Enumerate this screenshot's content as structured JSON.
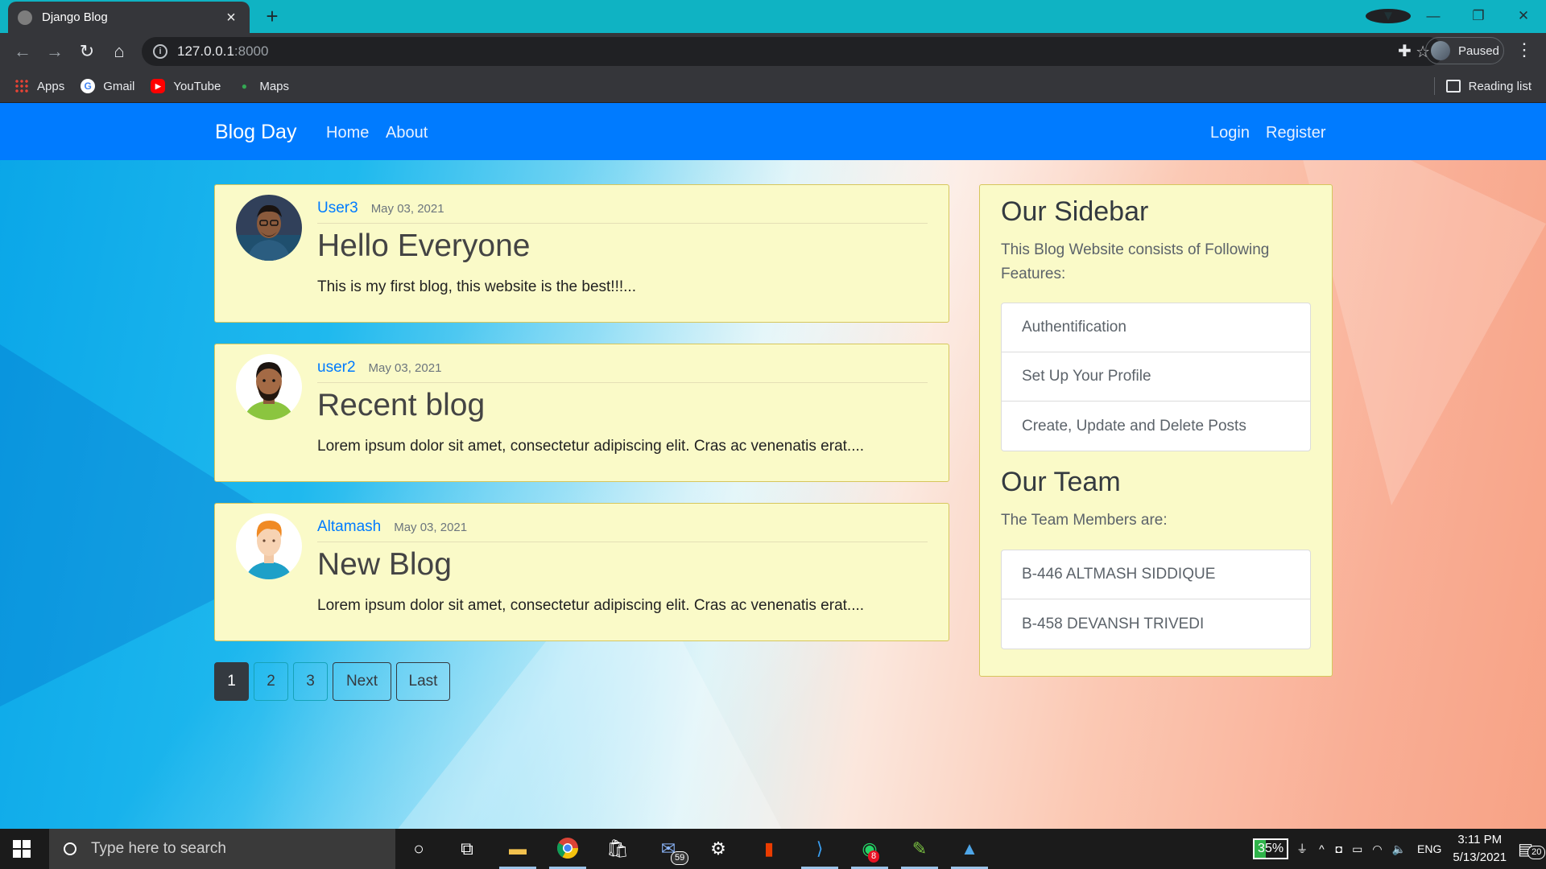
{
  "browser": {
    "tab_title": "Django Blog",
    "close_tab": "×",
    "new_tab": "+",
    "url_host": "127.0.0.1",
    "url_port": ":8000",
    "profile_status": "Paused",
    "bookmarks": [
      {
        "label": "Apps",
        "icon": "apps-grid-icon"
      },
      {
        "label": "Gmail",
        "icon": "gmail-icon"
      },
      {
        "label": "YouTube",
        "icon": "youtube-icon"
      },
      {
        "label": "Maps",
        "icon": "maps-icon"
      }
    ],
    "reading_list": "Reading list"
  },
  "navbar": {
    "brand": "Blog Day",
    "links": [
      "Home",
      "About"
    ],
    "auth_links": [
      "Login",
      "Register"
    ],
    "color": "#007bff"
  },
  "posts": [
    {
      "author": "User3",
      "date": "May 03, 2021",
      "title": "Hello Everyone",
      "excerpt": "This is my first blog, this website is the best!!!..."
    },
    {
      "author": "user2",
      "date": "May 03, 2021",
      "title": "Recent blog",
      "excerpt": "Lorem ipsum dolor sit amet, consectetur adipiscing elit. Cras ac venenatis erat...."
    },
    {
      "author": "Altamash",
      "date": "May 03, 2021",
      "title": "New Blog",
      "excerpt": "Lorem ipsum dolor sit amet, consectetur adipiscing elit. Cras ac venenatis erat...."
    }
  ],
  "pagination": {
    "pages": [
      "1",
      "2",
      "3"
    ],
    "current": "1",
    "next": "Next",
    "last": "Last"
  },
  "sidebar": {
    "title": "Our Sidebar",
    "description": "This Blog Website consists of Following Features:",
    "features": [
      "Authentification",
      "Set Up Your Profile",
      "Create, Update and Delete Posts"
    ],
    "team_title": "Our Team",
    "team_description": "The Team Members are:",
    "team_members": [
      "B-446 ALTMASH SIDDIQUE",
      "B-458 DEVANSH TRIVEDI"
    ]
  },
  "taskbar": {
    "search_placeholder": "Type here to search",
    "mail_badge": "59",
    "whatsapp_badge": "8",
    "battery": "35%",
    "language": "ENG",
    "time": "3:11 PM",
    "date": "5/13/2021",
    "notifications": "20"
  }
}
